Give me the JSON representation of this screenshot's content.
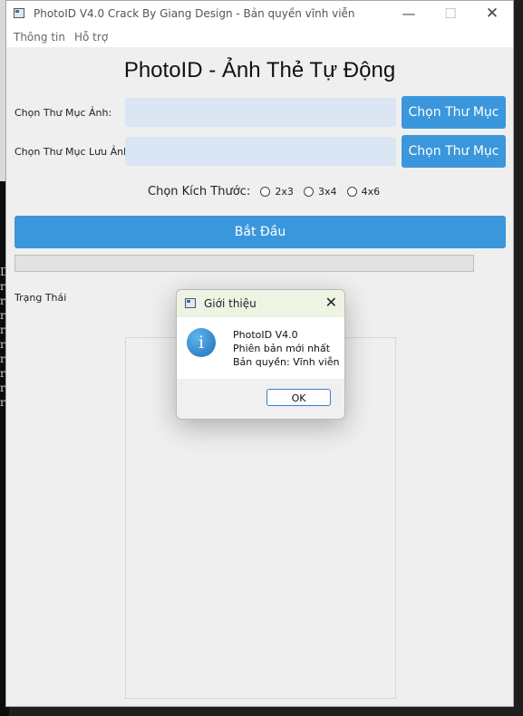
{
  "window": {
    "title": "PhotoID V4.0 Crack By Giang Design - Bản quyền vĩnh viễn",
    "controls": {
      "minimize": "—",
      "maximize": "☐",
      "close": "✕"
    }
  },
  "menubar": {
    "items": [
      "Thông tin",
      "Hỗ trợ"
    ]
  },
  "app": {
    "title": "PhotoID - Ảnh Thẻ Tự Động",
    "source_folder": {
      "label": "Chọn Thư Mục Ảnh:",
      "value": "",
      "button": "Chọn Thư Mục"
    },
    "output_folder": {
      "label": "Chọn Thư Mục Lưu Ảnh",
      "value": "",
      "button": "Chọn Thư Mục"
    },
    "size": {
      "label": "Chọn Kích Thước:",
      "options": [
        "2x3",
        "3x4",
        "4x6"
      ],
      "selected": null
    },
    "start_button": "Bắt Đầu",
    "progress": 0,
    "status_label": "Trạng Thái"
  },
  "dialog": {
    "title": "Giới thiệu",
    "close": "✕",
    "icon_glyph": "i",
    "lines": [
      "PhotoID V4.0",
      "Phiên bản mới nhất",
      "Bản quyền: Vĩnh viễn"
    ],
    "ok_button": "OK"
  },
  "background": {
    "glyphs": [
      "D",
      "r",
      "r",
      "r",
      "r",
      "r",
      "r",
      "r",
      "r",
      "r"
    ]
  },
  "colors": {
    "accent": "#3b97dc",
    "input_bg": "#dbe6f4",
    "dialog_title_bg": "#eef4e4"
  },
  "icons": {
    "app": "app-window-icon",
    "dialog_info": "info-icon"
  }
}
